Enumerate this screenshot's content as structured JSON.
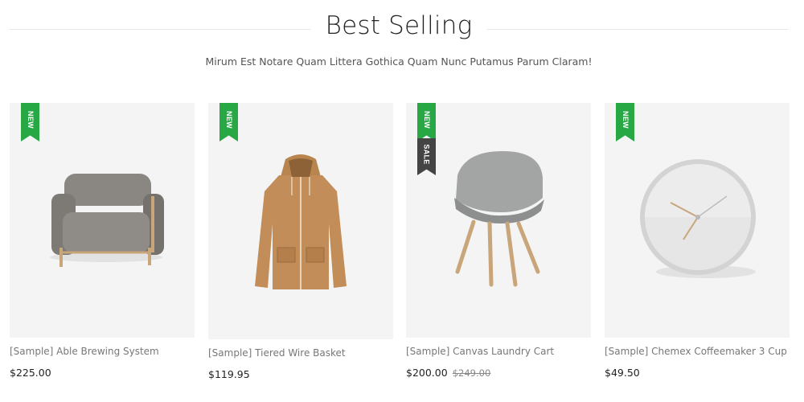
{
  "section": {
    "title": "Best Selling",
    "subtitle": "Mirum Est Notare Quam Littera Gothica Quam Nunc Putamus Parum Claram!"
  },
  "products": [
    {
      "name": "[Sample] Able Brewing System",
      "price": "$225.00",
      "old_price": "",
      "badges": [
        "NEW"
      ],
      "image": "armchair"
    },
    {
      "name": "[Sample] Tiered Wire Basket",
      "price": "$119.95",
      "old_price": "",
      "badges": [
        "NEW"
      ],
      "image": "jacket"
    },
    {
      "name": "[Sample] Canvas Laundry Cart",
      "price": "$200.00",
      "old_price": "$249.00",
      "badges": [
        "NEW",
        "SALE"
      ],
      "image": "chair"
    },
    {
      "name": "[Sample] Chemex Coffeemaker 3 Cup",
      "price": "$49.50",
      "old_price": "",
      "badges": [
        "NEW"
      ],
      "image": "clock"
    }
  ],
  "colors": {
    "new_badge": "#27a844",
    "sale_badge": "#444444",
    "image_bg": "#f4f4f4"
  }
}
